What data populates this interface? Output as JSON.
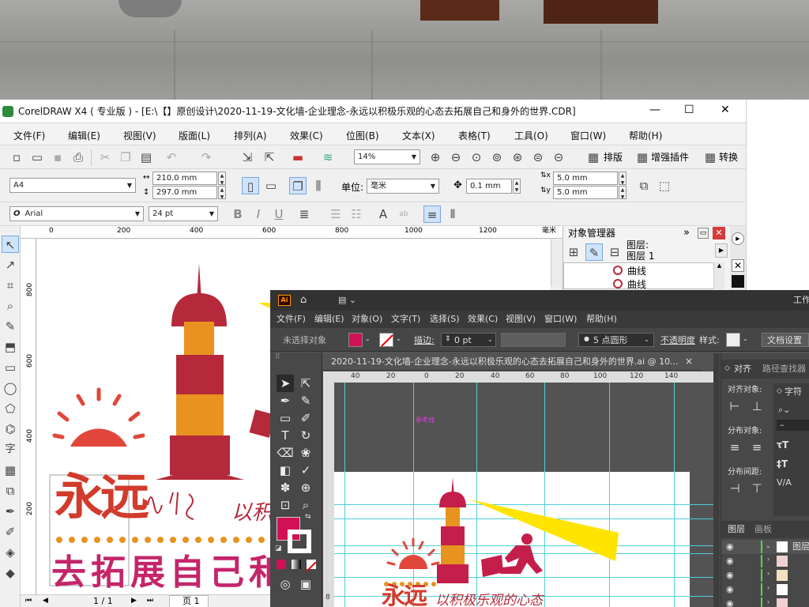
{
  "cdr": {
    "title": "CorelDRAW X4 ( 专业版 ) - [E:\\【】原创设计\\2020-11-19-文化墙-企业理念-永远以积极乐观的心态去拓展自己和身外的世界.CDR]",
    "window_buttons": {
      "minimize": "—",
      "maximize": "☐",
      "close": "✕"
    },
    "menu": [
      "文件(F)",
      "编辑(E)",
      "视图(V)",
      "版面(L)",
      "排列(A)",
      "效果(C)",
      "位图(B)",
      "文本(X)",
      "表格(T)",
      "工具(O)",
      "窗口(W)",
      "帮助(H)"
    ],
    "zoom": "14%",
    "toolbar_extras": [
      "排版",
      "增强插件",
      "转换"
    ],
    "page_preset": "A4",
    "width": "210.0 mm",
    "height": "297.0 mm",
    "unit_label": "单位:",
    "unit_value": "毫米",
    "nudge": "0.1 mm",
    "dup_x": "5.0 mm",
    "dup_y": "5.0 mm",
    "font": "Arial",
    "font_size": "24 pt",
    "ruler_top": [
      "200",
      "0",
      "200",
      "400",
      "600",
      "800",
      "1000",
      "1200"
    ],
    "ruler_unit": "毫米",
    "ruler_left": [
      "800",
      "600",
      "400",
      "200"
    ],
    "obj_mgr": {
      "title": "对象管理器",
      "layer": "图层:",
      "layer_name": "图层 1",
      "items": [
        "曲线",
        "曲线"
      ]
    },
    "page_nav": {
      "counter": "1 / 1",
      "tab": "页 1"
    },
    "artwork": {
      "big": "永远",
      "script": "以积极",
      "bottom": "去拓展自己和"
    },
    "toolbox_labels": [
      "字"
    ],
    "colors": {
      "dark_red": "#b5293a",
      "orange": "#e8931f",
      "sun": "#e0473a",
      "pink": "#c4256a",
      "beam": "#ffe400"
    }
  },
  "ai": {
    "app_icon": "Ai",
    "menu": [
      "文件(F)",
      "编辑(E)",
      "对象(O)",
      "文字(T)",
      "选择(S)",
      "效果(C)",
      "视图(V)",
      "窗口(W)",
      "帮助(H)"
    ],
    "work": "工作",
    "control": {
      "no_sel": "未选择对象",
      "stroke_label": "描边:",
      "stroke_val": "0 pt",
      "brush": "5 点圆形",
      "opacity": "不透明度",
      "style": "样式:",
      "doc": "文档设置"
    },
    "doc_tab": "2020-11-19-文化墙-企业理念-永远以积极乐观的心态去拓展自己和身外的世界.ai @ 10...",
    "doc_close": "×",
    "ruler": [
      "40",
      "20",
      "0",
      "20",
      "40",
      "60",
      "80",
      "100",
      "120",
      "140"
    ],
    "guide_label": "参考线",
    "panels": {
      "align_tab": "对齐",
      "pathfinder_tab": "路径查找器",
      "align_obj": "对齐对象:",
      "dist_obj": "分布对象:",
      "dist_space": "分布间距:",
      "char": "字符",
      "layers_tab": "图层",
      "artboard_tab": "画板",
      "layers_label": "图层"
    },
    "artwork": {
      "big": "永远",
      "script": "以积极乐观的心态"
    },
    "ruler_left": [
      "8"
    ]
  }
}
